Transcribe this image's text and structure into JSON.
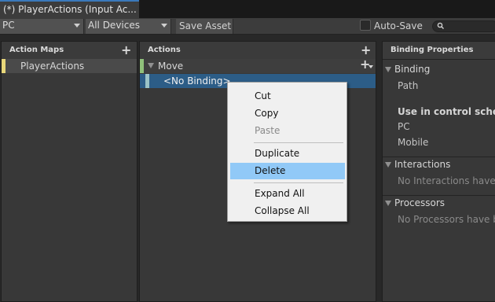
{
  "window": {
    "tab_title": "(*) PlayerActions (Input Ac..."
  },
  "toolbar": {
    "control_scheme": "PC",
    "devices": "All Devices",
    "save_label": "Save Asset",
    "autosave_label": "Auto-Save",
    "autosave_checked": false
  },
  "action_maps": {
    "header": "Action Maps",
    "add_icon": "plus-icon",
    "items": [
      {
        "label": "PlayerActions",
        "color": "#e8d77a"
      }
    ]
  },
  "actions": {
    "header": "Actions",
    "add_icon": "plus-icon",
    "items": [
      {
        "label": "Move",
        "color": "#8fc07a"
      },
      {
        "label": "<No Binding>",
        "color": "#9bc3c7",
        "selected": true
      }
    ]
  },
  "properties": {
    "header": "Binding Properties",
    "binding_section": "Binding",
    "path_label": "Path",
    "schemes_label": "Use in control scheme",
    "schemes": [
      "PC",
      "Mobile"
    ],
    "interactions_section": "Interactions",
    "interactions_empty": "No Interactions have b",
    "processors_section": "Processors",
    "processors_empty": "No Processors have be"
  },
  "context_menu": {
    "items": [
      {
        "label": "Cut",
        "enabled": true
      },
      {
        "label": "Copy",
        "enabled": true
      },
      {
        "label": "Paste",
        "enabled": false
      },
      {
        "label": "Duplicate",
        "enabled": true
      },
      {
        "label": "Delete",
        "enabled": true,
        "highlighted": true
      },
      {
        "label": "Expand All",
        "enabled": true
      },
      {
        "label": "Collapse All",
        "enabled": true
      }
    ]
  },
  "colors": {
    "selection": "#2c5d87",
    "menu_highlight": "#91c9f7"
  }
}
